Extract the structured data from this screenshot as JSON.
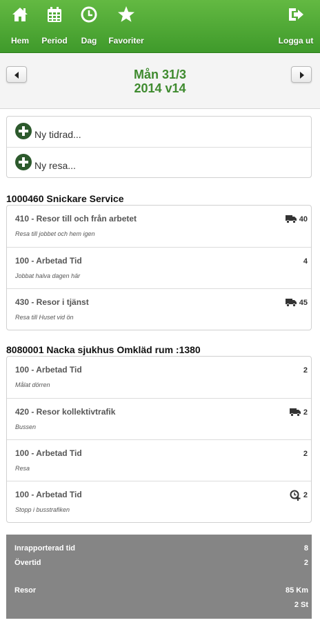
{
  "nav": {
    "home": {
      "label": "Hem",
      "icon": "home-icon"
    },
    "period": {
      "label": "Period",
      "icon": "calendar-icon"
    },
    "day": {
      "label": "Dag",
      "icon": "clock-icon"
    },
    "favorites": {
      "label": "Favoriter",
      "icon": "star-icon"
    },
    "logout": {
      "label": "Logga ut",
      "icon": "sign-out-icon"
    }
  },
  "date_header": {
    "line1": "Mån 31/3",
    "line2": "2014 v14"
  },
  "add_actions": [
    {
      "label": "Ny tidrad...",
      "icon": "plus-circle-icon"
    },
    {
      "label": "Ny resa...",
      "icon": "plus-circle-icon"
    }
  ],
  "sections": [
    {
      "title": "1000460 Snickare Service",
      "rows": [
        {
          "title": "410 - Resor till och från arbetet",
          "subtitle": "Resa till jobbet och hem igen",
          "value": "40",
          "icon": "truck-icon"
        },
        {
          "title": "100 - Arbetad Tid",
          "subtitle": "Jobbat halva dagen här",
          "value": "4",
          "icon": ""
        },
        {
          "title": "430 - Resor i tjänst",
          "subtitle": "Resa till Huset vid ön",
          "value": "45",
          "icon": "truck-icon"
        }
      ]
    },
    {
      "title": "8080001 Nacka sjukhus Omkläd rum :1380",
      "rows": [
        {
          "title": "100 - Arbetad Tid",
          "subtitle": "Målat dörren",
          "value": "2",
          "icon": ""
        },
        {
          "title": "420 - Resor kollektivtrafik",
          "subtitle": "Bussen",
          "value": "2",
          "icon": "truck-icon"
        },
        {
          "title": "100 - Arbetad Tid",
          "subtitle": "Resa",
          "value": "2",
          "icon": ""
        },
        {
          "title": "100 - Arbetad Tid",
          "subtitle": "Stopp i busstrafiken",
          "value": "2",
          "icon": "clock-plus-icon"
        }
      ]
    }
  ],
  "summary": {
    "reported_label": "Inrapporterad tid",
    "reported_value": "8",
    "overtime_label": "Övertid",
    "overtime_value": "2",
    "trips_label": "Resor",
    "trips_km": "85 Km",
    "trips_count": "2 St"
  },
  "colors": {
    "nav_green": "#4fa935",
    "date_green": "#3e8a2e",
    "plus_green": "#2d5a2d",
    "summary_gray": "#858585"
  }
}
